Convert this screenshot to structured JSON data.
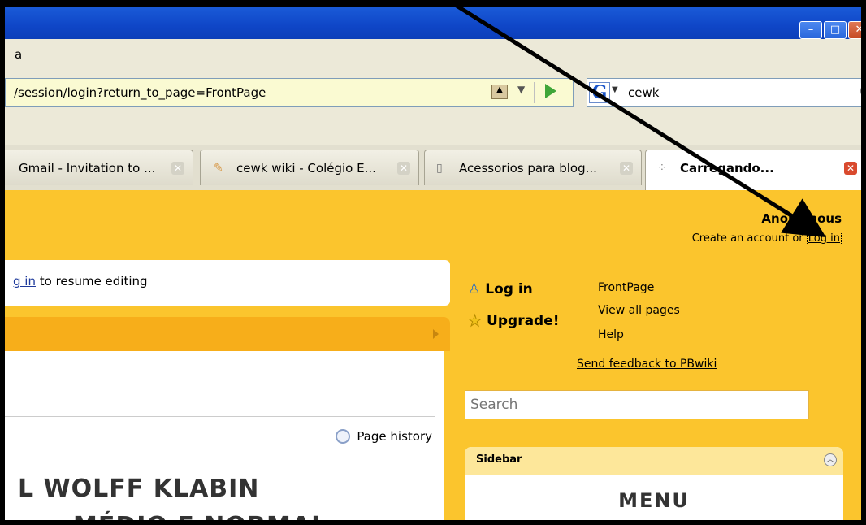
{
  "menubar": {
    "text": "a"
  },
  "navbar": {
    "url": "/session/login?return_to_page=FrontPage",
    "search_engine_letter": "G",
    "search_query": "cewk"
  },
  "tabs": [
    {
      "title": "Gmail - Invitation to ...",
      "active": false
    },
    {
      "title": "cewk wiki - Colégio E...",
      "active": false
    },
    {
      "title": "Acessorios para blog...",
      "active": false
    },
    {
      "title": "Carregando...",
      "active": true
    }
  ],
  "page": {
    "user": "Anonymous",
    "create_account": "Create an account",
    "or": "or",
    "login_link": "Log in",
    "message_link": "g in",
    "message_text": " to resume editing",
    "page_history": "Page history",
    "heading_line1": "L WOLFF KLABIN",
    "heading_line2": "MÉDIO E NORMAL",
    "sidebar_login": "Log in",
    "sidebar_upgrade": "Upgrade!",
    "nav_links": [
      "FrontPage",
      "View all pages",
      "Help"
    ],
    "feedback": "Send feedback to PBwiki",
    "search_placeholder": "Search",
    "sidebar_title": "Sidebar",
    "sidebar_menu": "MENU"
  }
}
